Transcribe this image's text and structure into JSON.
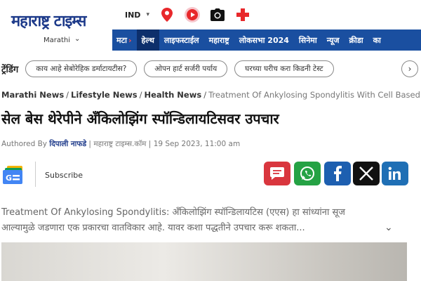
{
  "header": {
    "logo": "महाराष्ट्र टाइम्स",
    "lang_current": "Marathi",
    "region": "IND"
  },
  "nav": {
    "items": [
      "मटा",
      "हेल्थ",
      "लाइफस्टाईल",
      "महाराष्ट्र",
      "लोकसभा 2024",
      "सिनेमा",
      "न्यूज",
      "क्रीडा",
      "का"
    ]
  },
  "trending": {
    "label": "ट्रेंडिंग",
    "items": [
      "काय आहे सेबोरेहिक डर्माटायटीस?",
      "ओपन हार्ट सर्जरी पर्याय",
      "घरच्या घरीच करा किडनी टेस्ट"
    ]
  },
  "breadcrumb": {
    "items": [
      "Marathi News",
      "Lifestyle News",
      "Health News"
    ],
    "current": "Treatment Of Ankylosing Spondylitis With Cell Based Therapy"
  },
  "article": {
    "title": "सेल बेस थेरेपीने अँकिलोझिंग स्पॉन्डिलायटिसवर उपचार",
    "authored_by_label": "Authored By",
    "author": "दिपाली नाफडे",
    "publisher": "महाराष्ट्र टाइम्स.कॉम",
    "date": "19 Sep 2023, 11:00 am",
    "summary": "Treatment Of Ankylosing Spondylitis: अँकिलोझिंग स्पॉन्डिलायटिस (एएस) हा सांध्यांना सूज आल्यामुळे जडणारा एक प्रकारचा वातविकार आहे. यावर कशा पद्धतीने उपचार करू शकता..."
  },
  "share": {
    "subscribe_label": "Subscribe",
    "colors": {
      "comment": "#d9363e",
      "whatsapp": "#25a244",
      "facebook": "#1d5fb0",
      "x": "#111111",
      "linkedin": "#1f6fb5"
    }
  },
  "colors": {
    "nav_bg": "#1a4fa0",
    "logo": "#1d3a8a"
  }
}
